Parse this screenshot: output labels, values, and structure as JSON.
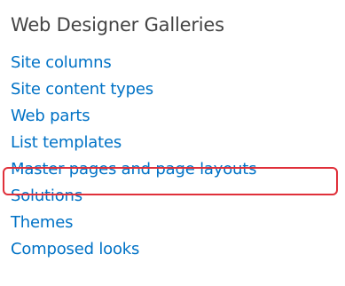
{
  "gallery": {
    "heading": "Web Designer Galleries",
    "links": [
      {
        "label": "Site columns"
      },
      {
        "label": "Site content types"
      },
      {
        "label": "Web parts"
      },
      {
        "label": "List templates"
      },
      {
        "label": "Master pages and page layouts",
        "highlighted": true
      },
      {
        "label": "Solutions"
      },
      {
        "label": "Themes"
      },
      {
        "label": "Composed looks"
      }
    ]
  },
  "colors": {
    "heading": "#444444",
    "link": "#0072c6",
    "highlight_border": "#e0303a"
  }
}
